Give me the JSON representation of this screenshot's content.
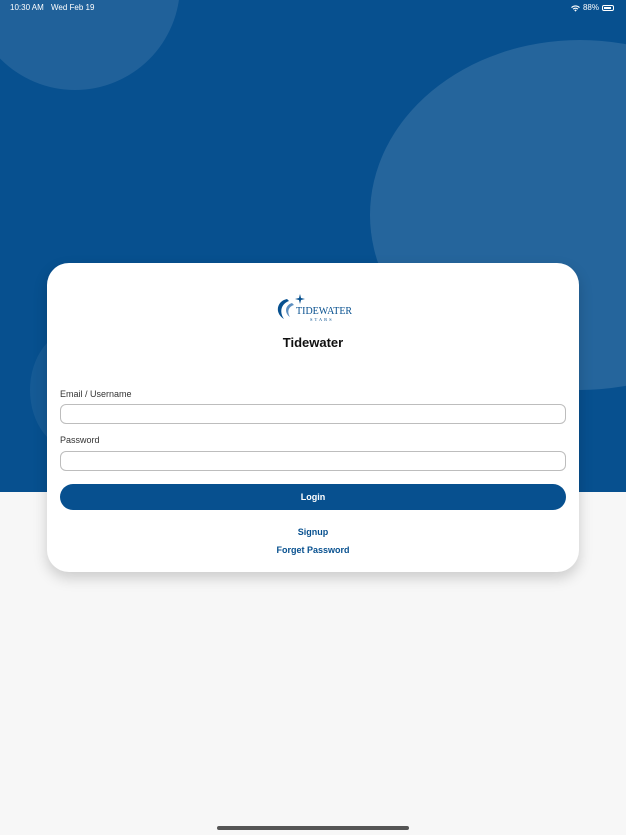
{
  "status_bar": {
    "time": "10:30 AM",
    "date": "Wed Feb 19",
    "battery": "88%"
  },
  "logo": {
    "brand_text": "TIDEWATER",
    "sub_text": "STARS"
  },
  "card": {
    "title": "Tidewater",
    "email_label": "Email / Username",
    "email_value": "",
    "email_placeholder": "",
    "password_label": "Password",
    "password_value": "",
    "password_placeholder": "",
    "login_label": "Login",
    "signup_label": "Signup",
    "forgot_label": "Forget Password"
  },
  "colors": {
    "brand_blue": "#07508f",
    "background": "#f7f7f7",
    "card": "#ffffff"
  }
}
